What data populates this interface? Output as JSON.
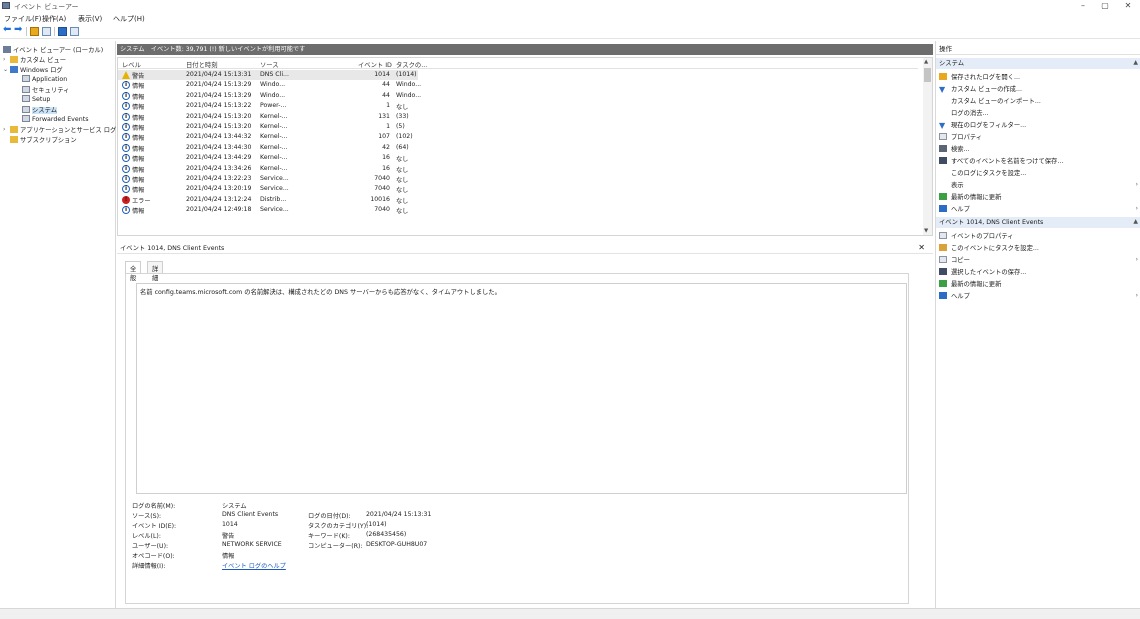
{
  "window": {
    "title": "イベント ビューアー",
    "minimize": "–",
    "maximize": "▢",
    "close": "✕"
  },
  "menu": [
    "ファイル(F)",
    "操作(A)",
    "表示(V)",
    "ヘルプ(H)"
  ],
  "tree": {
    "root": "イベント ビューアー (ローカル)",
    "custom_views": "カスタム ビュー",
    "windows_logs": "Windows ログ",
    "application": "Application",
    "security": "セキュリティ",
    "setup": "Setup",
    "system": "システム",
    "forwarded": "Forwarded Events",
    "apps_services": "アプリケーションとサービス ログ",
    "subscriptions": "サブスクリプション"
  },
  "list": {
    "header": "システム　イベント数: 39,791 (!) 新しいイベントが利用可能です",
    "columns": [
      "レベル",
      "日付と時刻",
      "ソース",
      "イベント ID",
      "タスクの..."
    ],
    "rows": [
      {
        "level": "警告",
        "type": "warn",
        "date": "2021/04/24 15:13:31",
        "source": "DNS Cli...",
        "id": "1014",
        "task": "(1014)"
      },
      {
        "level": "情報",
        "type": "info",
        "date": "2021/04/24 15:13:29",
        "source": "Windo...",
        "id": "44",
        "task": "Windo..."
      },
      {
        "level": "情報",
        "type": "info",
        "date": "2021/04/24 15:13:29",
        "source": "Windo...",
        "id": "44",
        "task": "Windo..."
      },
      {
        "level": "情報",
        "type": "info",
        "date": "2021/04/24 15:13:22",
        "source": "Power-...",
        "id": "1",
        "task": "なし"
      },
      {
        "level": "情報",
        "type": "info",
        "date": "2021/04/24 15:13:20",
        "source": "Kernel-...",
        "id": "131",
        "task": "(33)"
      },
      {
        "level": "情報",
        "type": "info",
        "date": "2021/04/24 15:13:20",
        "source": "Kernel-...",
        "id": "1",
        "task": "(5)"
      },
      {
        "level": "情報",
        "type": "info",
        "date": "2021/04/24 13:44:32",
        "source": "Kernel-...",
        "id": "107",
        "task": "(102)"
      },
      {
        "level": "情報",
        "type": "info",
        "date": "2021/04/24 13:44:30",
        "source": "Kernel-...",
        "id": "42",
        "task": "(64)"
      },
      {
        "level": "情報",
        "type": "info",
        "date": "2021/04/24 13:44:29",
        "source": "Kernel-...",
        "id": "16",
        "task": "なし"
      },
      {
        "level": "情報",
        "type": "info",
        "date": "2021/04/24 13:34:26",
        "source": "Kernel-...",
        "id": "16",
        "task": "なし"
      },
      {
        "level": "情報",
        "type": "info",
        "date": "2021/04/24 13:22:23",
        "source": "Service...",
        "id": "7040",
        "task": "なし"
      },
      {
        "level": "情報",
        "type": "info",
        "date": "2021/04/24 13:20:19",
        "source": "Service...",
        "id": "7040",
        "task": "なし"
      },
      {
        "level": "エラー",
        "type": "err",
        "date": "2021/04/24 13:12:24",
        "source": "Distrib...",
        "id": "10016",
        "task": "なし"
      },
      {
        "level": "情報",
        "type": "info",
        "date": "2021/04/24 12:49:18",
        "source": "Service...",
        "id": "7040",
        "task": "なし"
      }
    ]
  },
  "detail": {
    "title": "イベント 1014, DNS Client Events",
    "tabs": [
      "全般",
      "詳細"
    ],
    "message": "名前 config.teams.microsoft.com の名前解決は、構成されたどの DNS サーバーからも応答がなく、タイムアウトしました。",
    "props": {
      "log_name_label": "ログの名前(M):",
      "log_name": "システム",
      "source_label": "ソース(S):",
      "source": "DNS Client Events",
      "logged_label": "ログの日付(D):",
      "logged": "2021/04/24 15:13:31",
      "event_id_label": "イベント ID(E):",
      "event_id": "1014",
      "task_label": "タスクのカテゴリ(Y):",
      "task": "(1014)",
      "level_label": "レベル(L):",
      "level": "警告",
      "keywords_label": "キーワード(K):",
      "keywords": "(268435456)",
      "user_label": "ユーザー(U):",
      "user": "NETWORK SERVICE",
      "computer_label": "コンピューター(R):",
      "computer": "DESKTOP-GUH8U07",
      "opcode_label": "オペコード(O):",
      "opcode": "情報",
      "more_label": "詳細情報(I):",
      "more_link": "イベント ログのヘルプ"
    }
  },
  "actions": {
    "header": "操作",
    "section1": "システム",
    "items1": [
      "保存されたログを開く...",
      "カスタム ビューの作成...",
      "カスタム ビューのインポート...",
      "ログの消去...",
      "現在のログをフィルター...",
      "プロパティ",
      "検索...",
      "すべてのイベントを名前をつけて保存...",
      "このログにタスクを設定...",
      "表示",
      "最新の情報に更新",
      "ヘルプ"
    ],
    "section2": "イベント 1014, DNS Client Events",
    "items2": [
      "イベントのプロパティ",
      "このイベントにタスクを設定...",
      "コピー",
      "選択したイベントの保存...",
      "最新の情報に更新",
      "ヘルプ"
    ]
  },
  "colors": {
    "accent": "#1f6fd6",
    "selection": "#cce4f7",
    "section": "#e3ecf7",
    "warn": "#e5b400",
    "error": "#d11d1d"
  }
}
